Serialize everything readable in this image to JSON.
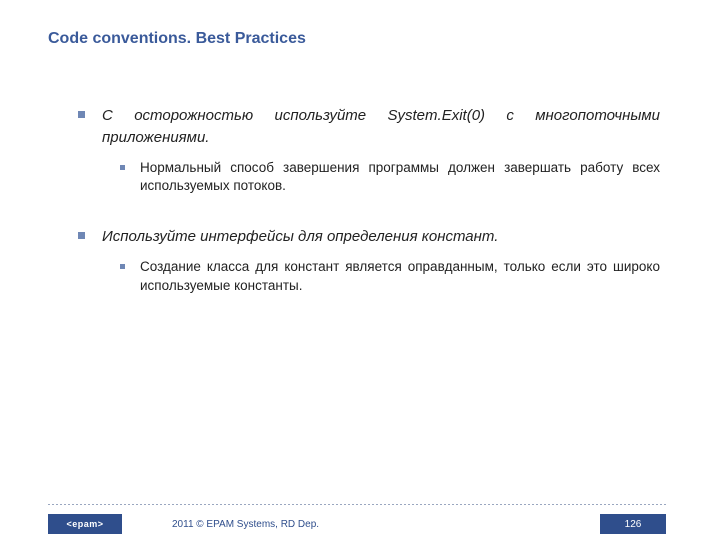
{
  "title": "Code conventions. Best Practices",
  "bullets": [
    {
      "main": "С осторожностью используйте System.Exit(0) с многопоточными приложениями.",
      "sub": [
        "Нормальный способ завершения программы должен завершать работу всех используемых потоков."
      ]
    },
    {
      "main": "Используйте интерфейсы для определения констант.",
      "sub": [
        "Создание класса для констант является оправданным, только если это широко используемые константы."
      ]
    }
  ],
  "footer": {
    "logo": "<epam>",
    "copyright": "2011 © EPAM Systems, RD Dep.",
    "page": "126"
  }
}
